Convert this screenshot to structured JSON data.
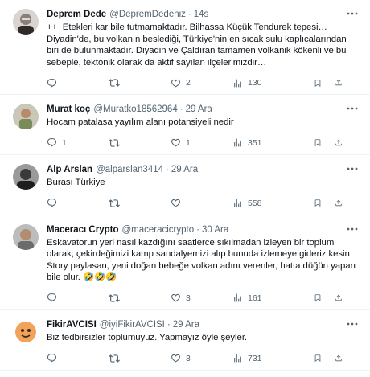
{
  "tweets": [
    {
      "name": "Deprem Dede",
      "handle": "@DepremDedeniz",
      "time": "14s",
      "text": "+++Etekleri kar bile tutmamaktadır. Bilhassa Küçük Tendurek tepesi… Diyadin'de, bu volkanın beslediği, Türkiye'nin en sıcak sulu kaplıcalarından biri de bulunmaktadır. Diyadin ve Çaldıran tamamen volkanik kökenli ve bu sebeple, tektonik olarak da aktif sayılan ilçelerimizdir…",
      "replies": "",
      "retweets": "",
      "likes": "2",
      "views": "130",
      "avatar_color": "#8a7f78"
    },
    {
      "name": "Murat koç",
      "handle": "@Muratko18562964",
      "time": "29 Ara",
      "text": "Hocam patalasa yayılım alanı potansiyeli nedir",
      "replies": "1",
      "retweets": "",
      "likes": "1",
      "views": "351",
      "avatar_color": "#7a8a5a"
    },
    {
      "name": "Alp Arslan",
      "handle": "@alparslan3414",
      "time": "29 Ara",
      "text": "Burası Türkiye",
      "replies": "",
      "retweets": "",
      "likes": "",
      "views": "558",
      "avatar_color": "#3a3a3a"
    },
    {
      "name": "Maceracı Crypto",
      "handle": "@maceracicrypto",
      "time": "30 Ara",
      "text": "Eskavatorun yeri nasıl kazdığını saatlerce sıkılmadan izleyen bir toplum olarak, çekirdeğimizi kamp sandalyemizi alıp bunuda izlemeye gideriz kesin. Story paylasan, yeni doğan bebeğe volkan adını verenler, hatta düğün yapan bile olur. 🤣🤣🤣",
      "replies": "",
      "retweets": "",
      "likes": "3",
      "views": "161",
      "avatar_color": "#6b6b6b"
    },
    {
      "name": "FikirAVCISI",
      "handle": "@iyiFikirAVCISI",
      "time": "29 Ara",
      "text": "Biz tedbirsizler toplumuyuz. Yapmayız öyle şeyler.",
      "replies": "",
      "retweets": "",
      "likes": "3",
      "views": "731",
      "avatar_color": "#f2a25a"
    }
  ],
  "colors": {
    "text": "#0f1419",
    "muted": "#536471",
    "divider": "#eff3f4"
  }
}
